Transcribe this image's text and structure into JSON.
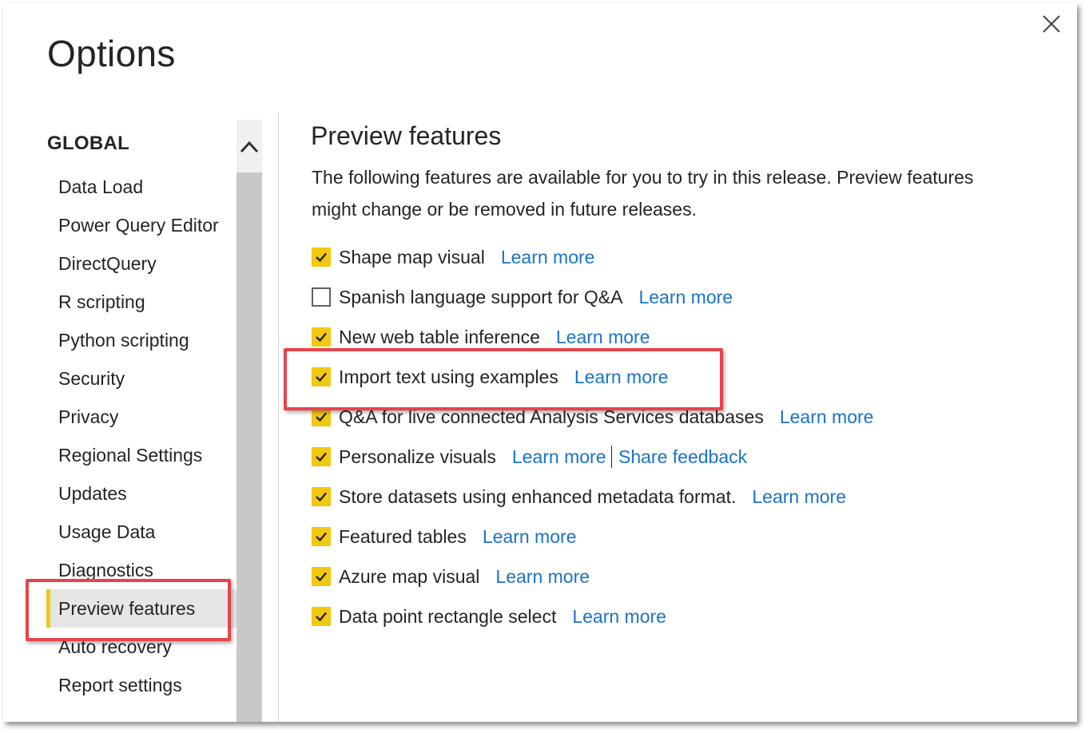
{
  "dialog": {
    "title": "Options",
    "close_icon": "close-icon"
  },
  "sidebar": {
    "section_heading": "GLOBAL",
    "items": [
      {
        "label": "Data Load",
        "selected": false
      },
      {
        "label": "Power Query Editor",
        "selected": false
      },
      {
        "label": "DirectQuery",
        "selected": false
      },
      {
        "label": "R scripting",
        "selected": false
      },
      {
        "label": "Python scripting",
        "selected": false
      },
      {
        "label": "Security",
        "selected": false
      },
      {
        "label": "Privacy",
        "selected": false
      },
      {
        "label": "Regional Settings",
        "selected": false
      },
      {
        "label": "Updates",
        "selected": false
      },
      {
        "label": "Usage Data",
        "selected": false
      },
      {
        "label": "Diagnostics",
        "selected": false
      },
      {
        "label": "Preview features",
        "selected": true
      },
      {
        "label": "Auto recovery",
        "selected": false
      },
      {
        "label": "Report settings",
        "selected": false
      }
    ]
  },
  "content": {
    "title": "Preview features",
    "description": "The following features are available for you to try in this release. Preview features might change or be removed in future releases.",
    "features": [
      {
        "label": "Shape map visual",
        "checked": true,
        "link": "Learn more"
      },
      {
        "label": "Spanish language support for Q&A",
        "checked": false,
        "link": "Learn more"
      },
      {
        "label": "New web table inference",
        "checked": true,
        "link": "Learn more"
      },
      {
        "label": "Import text using examples",
        "checked": true,
        "link": "Learn more"
      },
      {
        "label": "Q&A for live connected Analysis Services databases",
        "checked": true,
        "link": "Learn more"
      },
      {
        "label": "Personalize visuals",
        "checked": true,
        "link": "Learn more",
        "link2": "Share feedback"
      },
      {
        "label": "Store datasets using enhanced metadata format.",
        "checked": true,
        "link": "Learn more"
      },
      {
        "label": "Featured tables",
        "checked": true,
        "link": "Learn more"
      },
      {
        "label": "Azure map visual",
        "checked": true,
        "link": "Learn more"
      },
      {
        "label": "Data point rectangle select",
        "checked": true,
        "link": "Learn more"
      }
    ]
  },
  "colors": {
    "accent": "#f2c811",
    "link": "#1a73c9",
    "highlight_box": "#e8434b",
    "selected_bg": "#e6e6e6"
  }
}
